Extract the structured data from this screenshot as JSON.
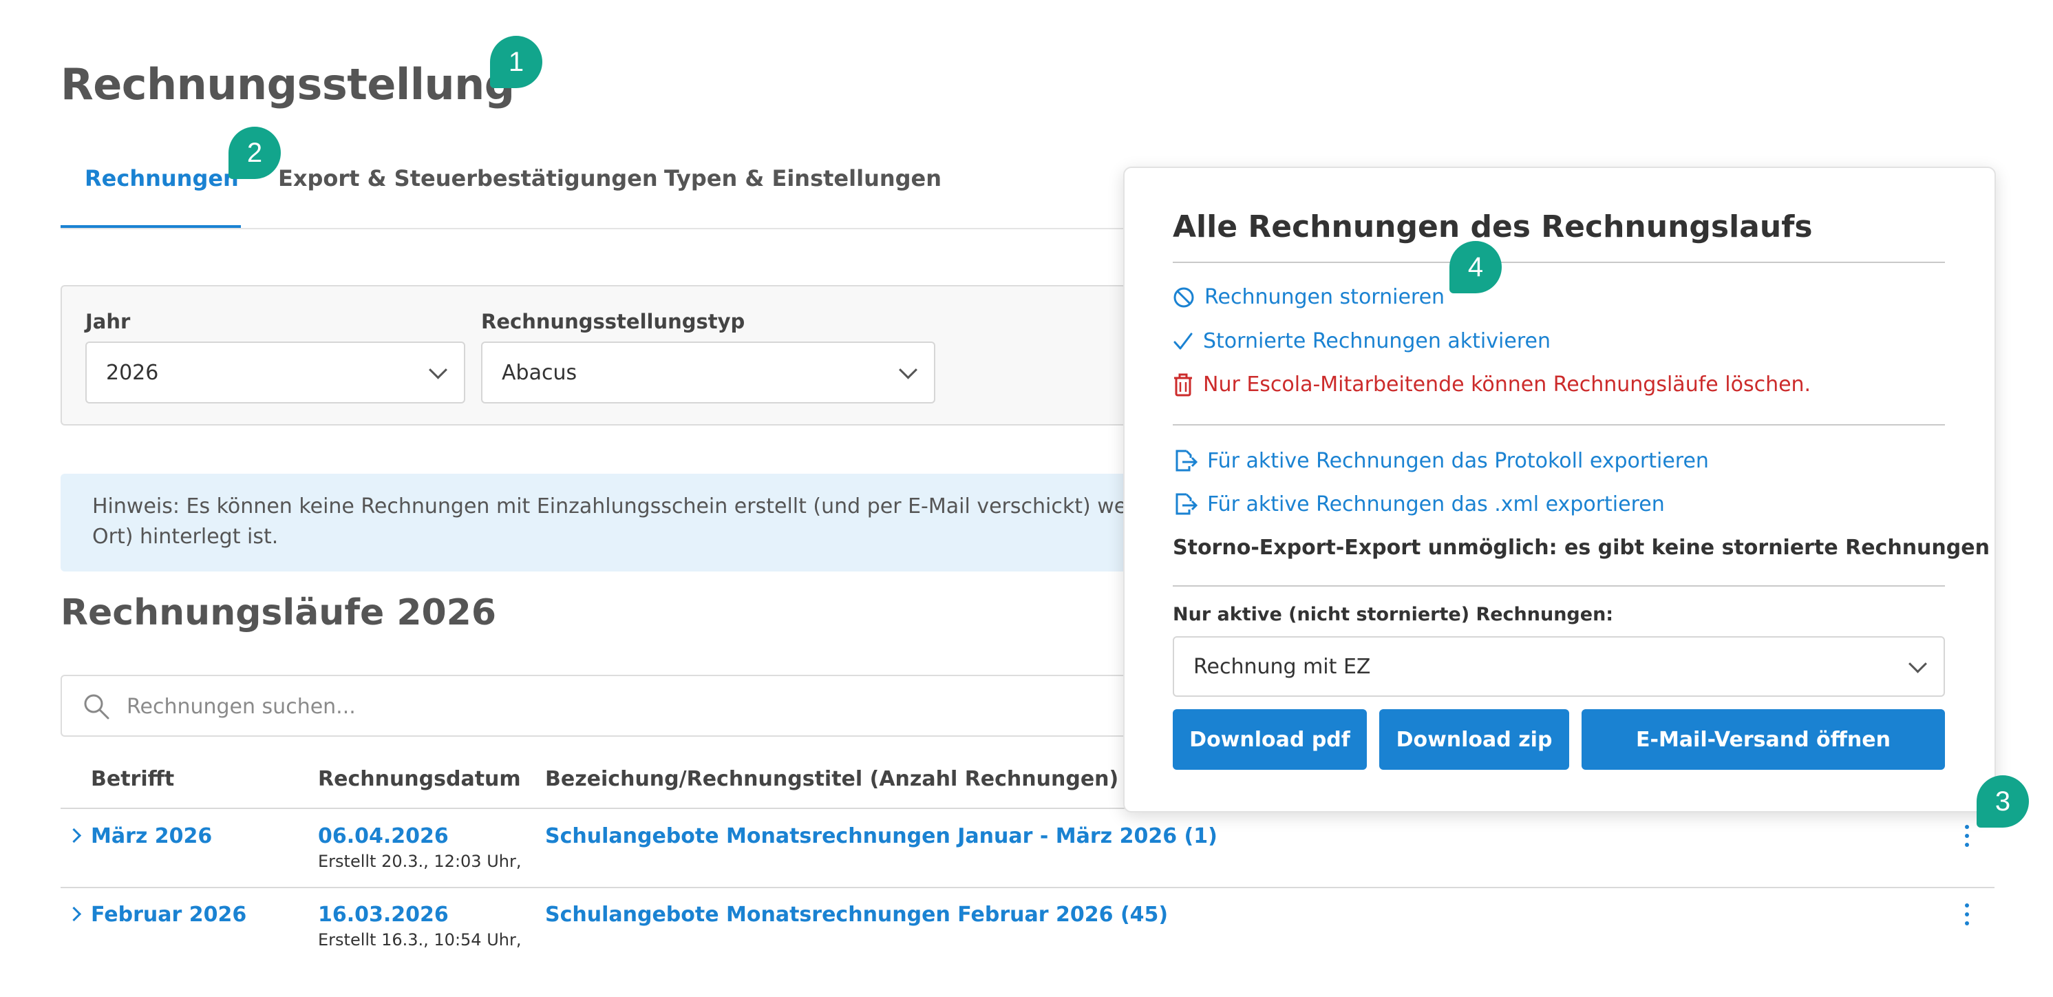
{
  "page": {
    "title": "Rechnungsstellung"
  },
  "tabs": [
    {
      "label": "Rechnungen",
      "active": true
    },
    {
      "label": "Export & Steuerbestätigungen",
      "active": false
    },
    {
      "label": "Typen & Einstellungen",
      "active": false
    }
  ],
  "filters": {
    "year_label": "Jahr",
    "year_value": "2026",
    "type_label": "Rechnungsstellungstyp",
    "type_value": "Abacus"
  },
  "hint": {
    "text": "Hinweis: Es können keine Rechnungen mit Einzahlungsschein erstellt (und per E-Mail verschickt) we",
    "text_line2": "Ort) hinterlegt ist."
  },
  "runs": {
    "title": "Rechnungsläufe 2026",
    "search_placeholder": "Rechnungen suchen...",
    "columns": [
      "Betrifft",
      "Rechnungsdatum",
      "Bezeichung/Rechnungstitel (Anzahl Rechnungen)"
    ],
    "rows": [
      {
        "subject": "März 2026",
        "date": "06.04.2026",
        "created": "Erstellt 20.3., 12:03 Uhr,",
        "title": "Schulangebote Monatsrechnungen Januar - März 2026 (1)"
      },
      {
        "subject": "Februar 2026",
        "date": "16.03.2026",
        "created": "Erstellt 16.3., 10:54 Uhr,",
        "title": "Schulangebote Monatsrechnungen Februar 2026 (45)"
      }
    ]
  },
  "popover": {
    "title": "Alle Rechnungen des Rechnungslaufs",
    "cancel_invoices": "Rechnungen stornieren",
    "activate_cancelled": "Stornierte Rechnungen aktivieren",
    "delete_notice": "Nur Escola-Mitarbeitende können Rechnungsläufe löschen.",
    "export_protocol": "Für aktive Rechnungen das Protokoll exportieren",
    "export_xml": "Für aktive Rechnungen das .xml exportieren",
    "storno_note": "Storno-Export-Export unmöglich: es gibt keine stornierte Rechnungen",
    "active_only_label": "Nur aktive (nicht stornierte) Rechnungen:",
    "select_value": "Rechnung mit EZ",
    "btn_pdf": "Download pdf",
    "btn_zip": "Download zip",
    "btn_email": "E-Mail-Versand öffnen"
  },
  "badges": [
    "1",
    "2",
    "3",
    "4"
  ],
  "colors": {
    "accent": "#1a82d2",
    "danger": "#cc2b2b",
    "badge": "#12a58c",
    "hint_bg": "#e5f2fb"
  }
}
